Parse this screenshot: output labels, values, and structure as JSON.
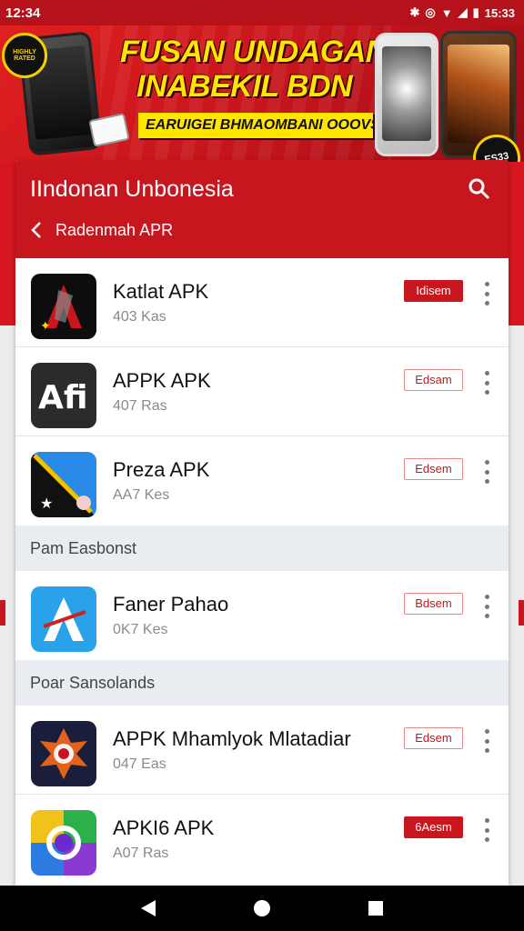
{
  "status_bar": {
    "time": "12:34",
    "battery": "15:33"
  },
  "banner": {
    "title_line1": "FUSAN UNDAGAN",
    "title_line2": "INABEKIL BDN",
    "strip_text": "EARUIGEI BHMAOMBANI OOOVS",
    "badge_left": "HIGHLY RATED",
    "badge_right": "ES33"
  },
  "app_bar": {
    "title": "IIndonan Unbonesia",
    "breadcrumb": "Radenmah APR"
  },
  "apps": [
    {
      "name": "Katlat APK",
      "sub": "403 Kas",
      "tag": "Idisem",
      "tag_style": "solid",
      "icon": "dark-a-icon"
    },
    {
      "name": "APPK APK",
      "sub": "407 Ras",
      "tag": "Edsam",
      "tag_style": "outline",
      "icon": "afi-icon"
    },
    {
      "name": "Preza APK",
      "sub": "AA7 Kes",
      "tag": "Edsem",
      "tag_style": "outline",
      "icon": "blue-star-icon"
    }
  ],
  "sections": [
    {
      "title": "Pam Easbonst",
      "apps": [
        {
          "name": "Faner Pahao",
          "sub": "0K7 Kes",
          "tag": "Bdsem",
          "tag_style": "outline",
          "icon": "blue-a-icon"
        }
      ]
    },
    {
      "title": "Poar Sansolands",
      "apps": [
        {
          "name": "APPK Mhamlyok Mlatadiar",
          "sub": "047 Eas",
          "tag": "Edsem",
          "tag_style": "outline",
          "icon": "orange-emblem-icon"
        },
        {
          "name": "APKI6 APK",
          "sub": "A07 Ras",
          "tag": "6Aesm",
          "tag_style": "solid",
          "icon": "ring-icon"
        }
      ]
    }
  ],
  "colors": {
    "brand_red": "#c8161e",
    "banner_yellow": "#ffe600"
  }
}
